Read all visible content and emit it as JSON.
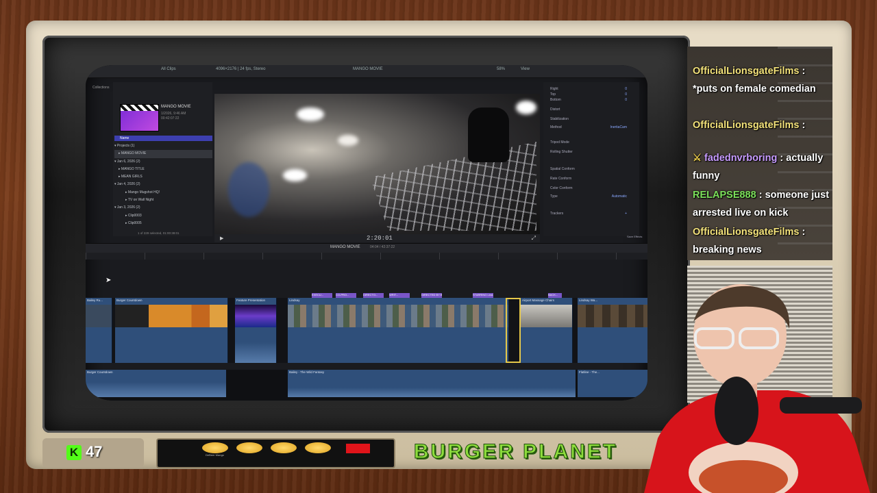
{
  "editor": {
    "top_left": "All Clips",
    "format": "4096×2176 | 24 fps, Stereo",
    "viewer_title": "MANGO MOVIE",
    "zoom": "58%",
    "view": "View",
    "project_thumb_title": "MANGO MOVIE",
    "project_thumb_meta": [
      "1/2026, 9:46 AM",
      "00:42:07:22"
    ],
    "sidebar_label": "Collections",
    "library_bar": "Name",
    "tree": [
      {
        "label": "Projects  (1)",
        "level": 0
      },
      {
        "label": "MANGO MOVIE",
        "level": 1,
        "selected": true
      },
      {
        "label": "Jan 6, 2026  (2)",
        "level": 0
      },
      {
        "label": "MANGO TITLE",
        "level": 1
      },
      {
        "label": "MEAN GIRLS",
        "level": 1
      },
      {
        "label": "Jan 4, 2026  (2)",
        "level": 0
      },
      {
        "label": "Mango Mugshot HQ!",
        "level": 2
      },
      {
        "label": "TV on Wall Night",
        "level": 2
      },
      {
        "label": "Jan 3, 2026  (2)",
        "level": 0
      },
      {
        "label": "Clip0003",
        "level": 2
      },
      {
        "label": "Clip0005",
        "level": 2
      }
    ],
    "selection_info": "1 of 229 selected, 01:00:38:01",
    "timecode": "2:20:01",
    "timeline_name": "MANGO MOVIE",
    "timeline_duration": "04:04 / 42:37:22",
    "inspector": [
      {
        "label": "Right",
        "value": "0"
      },
      {
        "label": "Top",
        "value": "0"
      },
      {
        "label": "Bottom",
        "value": "0"
      },
      {
        "label": "Distort",
        "value": ""
      },
      {
        "label": "Stabilization",
        "value": ""
      },
      {
        "label": "Method",
        "value": "InertiaCam"
      },
      {
        "label": "Tripod Mode",
        "value": ""
      },
      {
        "label": "Rolling Shutter",
        "value": ""
      },
      {
        "label": "Spatial Conform",
        "value": ""
      },
      {
        "label": "Rate Conform",
        "value": ""
      },
      {
        "label": "Color Conform",
        "value": ""
      },
      {
        "label": "Type",
        "value": "Automatic"
      },
      {
        "label": "Trackers",
        "value": "+"
      }
    ],
    "save_effects": "Save Effects",
    "clips": [
      {
        "label": "Bailey Ru...",
        "color": "#2f4f7a"
      },
      {
        "label": "Burger Countdown",
        "color": "#2f4f7a"
      },
      {
        "label": "Burger B...",
        "color": "#2f4f7a"
      },
      {
        "label": "Feature Presentation",
        "color": "#2f4f7a"
      },
      {
        "label": "Lindsay",
        "color": "#2f4f7a"
      },
      {
        "label": "Airport Massage Chairs",
        "color": "#2f4f7a"
      },
      {
        "label": "Lindsay Wa...",
        "color": "#2f4f7a"
      }
    ],
    "titles": [
      "EXECU...",
      "CO-PRO...",
      "DIRECTO...",
      "WRIT...",
      "DIRECTED BY  Ba...",
      "STARRING  Lind...",
      "BACK..."
    ],
    "audio_clips": [
      "Bailey Ru...",
      "Burger Countdown",
      "Bailey - The Wild Fantasy",
      "Flatline - The..."
    ]
  },
  "chat": [
    {
      "user": "OfficialLionsgateFilms",
      "text": "*puts on female comedian",
      "user_color": "#f3e27a"
    },
    {
      "user": "OfficialLionsgateFilms",
      "text": "",
      "user_color": "#f3e27a"
    },
    {
      "user": "fadednvrboring",
      "text": "actually funny",
      "user_color": "#c79bff"
    },
    {
      "user": "RELAPSE888",
      "text": "someone just arrested live on kick",
      "user_color": "#7be05a"
    },
    {
      "user": "OfficialLionsgateFilms",
      "text": "breaking news",
      "user_color": "#f3e27a"
    }
  ],
  "overlay": {
    "kick_logo": "K",
    "viewer_count": "47",
    "brand": "BURGER PLANET",
    "deck_label": "DeBeer Mango"
  }
}
